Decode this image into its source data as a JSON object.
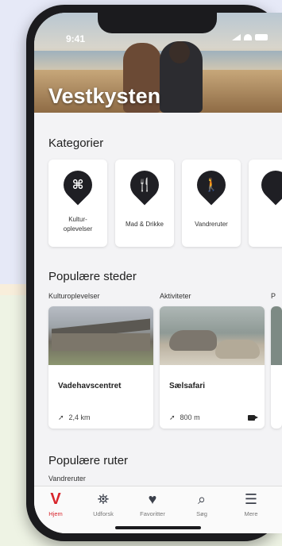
{
  "status": {
    "time": "9:41"
  },
  "hero": {
    "title": "Vestkysten"
  },
  "categories": {
    "title": "Kategorier",
    "items": [
      {
        "label": "Kultur-\noplevelser",
        "icon": "command-icon"
      },
      {
        "label": "Mad & Drikke",
        "icon": "fork-knife-icon"
      },
      {
        "label": "Vandreruter",
        "icon": "walking-person-icon"
      }
    ]
  },
  "popular_places": {
    "title": "Populære steder",
    "cards": [
      {
        "category": "Kulturoplevelser",
        "name": "Vadehavscentret",
        "distance": "2,4 km"
      },
      {
        "category": "Aktiviteter",
        "name": "Sælsafari",
        "distance": "800 m"
      }
    ],
    "next_category_partial": "P"
  },
  "popular_routes": {
    "title": "Populære ruter",
    "category": "Vandreruter"
  },
  "tabbar": {
    "items": [
      {
        "label": "Hjem",
        "icon": "home-v-icon",
        "active": true
      },
      {
        "label": "Udforsk",
        "icon": "map-pins-icon"
      },
      {
        "label": "Favoritter",
        "icon": "heart-icon"
      },
      {
        "label": "Søg",
        "icon": "search-icon"
      },
      {
        "label": "Mere",
        "icon": "menu-icon"
      }
    ]
  },
  "colors": {
    "accent": "#d8242b",
    "dark": "#1f1f24"
  }
}
